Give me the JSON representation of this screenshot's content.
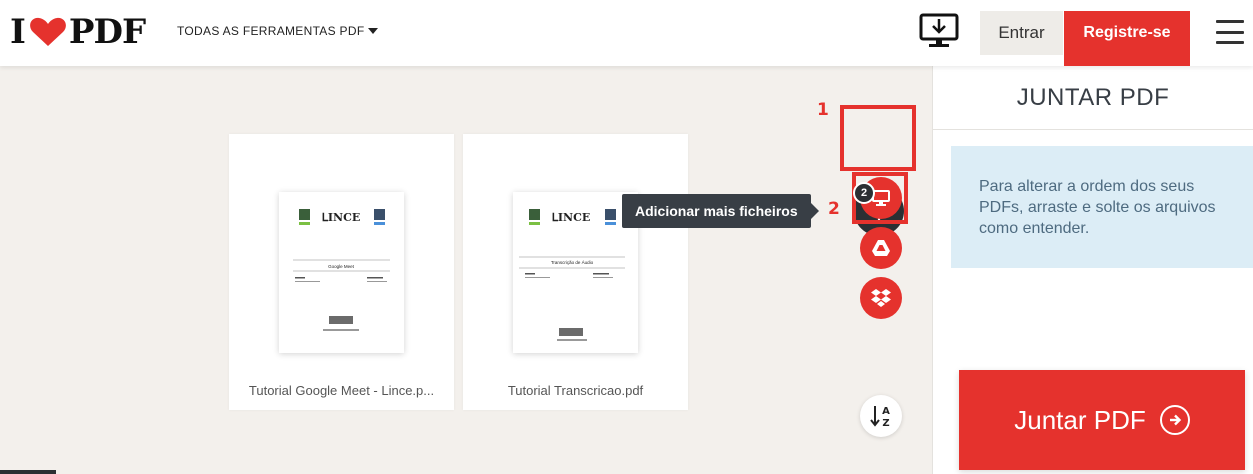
{
  "header": {
    "logo_text_left": "I",
    "logo_text_right": "PDF",
    "tools_menu_label": "TODAS AS FERRAMENTAS PDF",
    "login_label": "Entrar",
    "signup_label": "Registre-se"
  },
  "workspace": {
    "files": [
      {
        "name": "Tutorial Google Meet - Lince.p...",
        "doc_title": "Google Meet"
      },
      {
        "name": "Tutorial Transcricao.pdf",
        "doc_title": "Transcrição de Áudio"
      }
    ],
    "tooltip": "Adicionar mais ficheiros",
    "file_count": "2",
    "step1_label": "1",
    "step2_label": "2",
    "sort_label_top": "A",
    "sort_label_bottom": "Z"
  },
  "sidebar": {
    "title": "JUNTAR PDF",
    "info_text": "Para alterar a ordem dos seus PDFs, arraste e solte os arquivos como entender.",
    "merge_label": "Juntar PDF"
  },
  "colors": {
    "brand_red": "#e5322d",
    "dark": "#2b2f33",
    "info_bg": "#dcedf6",
    "workspace_bg": "#f3f0ec"
  },
  "icons": {
    "desktop": "desktop-download-icon",
    "add": "plus-icon",
    "computer": "computer-monitor-icon",
    "drive": "google-drive-icon",
    "dropbox": "dropbox-icon",
    "sort": "sort-az-icon",
    "menu": "hamburger-menu-icon",
    "merge_arrow": "arrow-circle-right-icon"
  }
}
